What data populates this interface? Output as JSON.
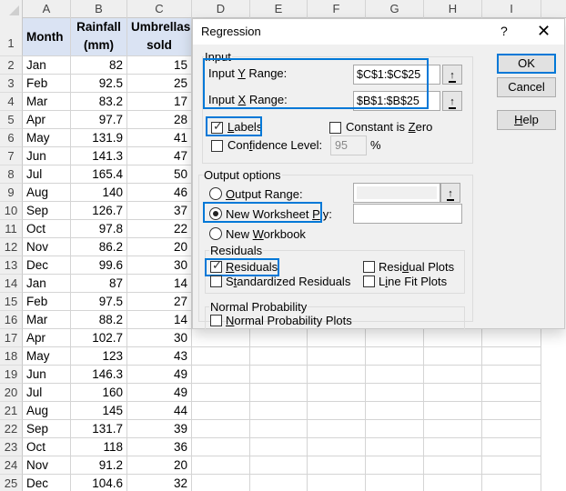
{
  "sheet": {
    "columns": [
      "A",
      "B",
      "C",
      "D",
      "E",
      "F",
      "G",
      "H",
      "I"
    ],
    "header_row_number": "1",
    "headers": {
      "month": "Month",
      "rainfall_line1": "Rainfall",
      "rainfall_line2": "(mm)",
      "umbrellas_line1": "Umbrellas",
      "umbrellas_line2": "sold"
    },
    "rows": [
      {
        "n": "2",
        "month": "Jan",
        "rainfall": "82",
        "umbrellas": "15"
      },
      {
        "n": "3",
        "month": "Feb",
        "rainfall": "92.5",
        "umbrellas": "25"
      },
      {
        "n": "4",
        "month": "Mar",
        "rainfall": "83.2",
        "umbrellas": "17"
      },
      {
        "n": "5",
        "month": "Apr",
        "rainfall": "97.7",
        "umbrellas": "28"
      },
      {
        "n": "6",
        "month": "May",
        "rainfall": "131.9",
        "umbrellas": "41"
      },
      {
        "n": "7",
        "month": "Jun",
        "rainfall": "141.3",
        "umbrellas": "47"
      },
      {
        "n": "8",
        "month": "Jul",
        "rainfall": "165.4",
        "umbrellas": "50"
      },
      {
        "n": "9",
        "month": "Aug",
        "rainfall": "140",
        "umbrellas": "46"
      },
      {
        "n": "10",
        "month": "Sep",
        "rainfall": "126.7",
        "umbrellas": "37"
      },
      {
        "n": "11",
        "month": "Oct",
        "rainfall": "97.8",
        "umbrellas": "22"
      },
      {
        "n": "12",
        "month": "Nov",
        "rainfall": "86.2",
        "umbrellas": "20"
      },
      {
        "n": "13",
        "month": "Dec",
        "rainfall": "99.6",
        "umbrellas": "30"
      },
      {
        "n": "14",
        "month": "Jan",
        "rainfall": "87",
        "umbrellas": "14"
      },
      {
        "n": "15",
        "month": "Feb",
        "rainfall": "97.5",
        "umbrellas": "27"
      },
      {
        "n": "16",
        "month": "Mar",
        "rainfall": "88.2",
        "umbrellas": "14"
      },
      {
        "n": "17",
        "month": "Apr",
        "rainfall": "102.7",
        "umbrellas": "30"
      },
      {
        "n": "18",
        "month": "May",
        "rainfall": "123",
        "umbrellas": "43"
      },
      {
        "n": "19",
        "month": "Jun",
        "rainfall": "146.3",
        "umbrellas": "49"
      },
      {
        "n": "20",
        "month": "Jul",
        "rainfall": "160",
        "umbrellas": "49"
      },
      {
        "n": "21",
        "month": "Aug",
        "rainfall": "145",
        "umbrellas": "44"
      },
      {
        "n": "22",
        "month": "Sep",
        "rainfall": "131.7",
        "umbrellas": "39"
      },
      {
        "n": "23",
        "month": "Oct",
        "rainfall": "118",
        "umbrellas": "36"
      },
      {
        "n": "24",
        "month": "Nov",
        "rainfall": "91.2",
        "umbrellas": "20"
      },
      {
        "n": "25",
        "month": "Dec",
        "rainfall": "104.6",
        "umbrellas": "32"
      }
    ]
  },
  "dialog": {
    "title": "Regression",
    "help_glyph": "?",
    "close_glyph": "✕",
    "input_group": {
      "label": "Input",
      "y_range": {
        "label_pre": "Input ",
        "label_key": "Y",
        "label_post": " Range:",
        "value": "$C$1:$C$25"
      },
      "x_range": {
        "label_pre": "Input ",
        "label_key": "X",
        "label_post": " Range:",
        "value": "$B$1:$B$25"
      },
      "labels": {
        "label_key": "L",
        "label_post": "abels",
        "checked": true
      },
      "constant_zero": {
        "label_pre": "Constant is ",
        "label_key": "Z",
        "label_post": "ero",
        "checked": false
      },
      "confidence": {
        "label_pre": "Con",
        "label_key": "f",
        "label_post": "idence Level:",
        "checked": false,
        "value": "95",
        "unit": "%"
      }
    },
    "output_group": {
      "label": "Output options",
      "output_range": {
        "label_key": "O",
        "label_post": "utput Range:",
        "selected": false,
        "value": ""
      },
      "new_worksheet": {
        "label_pre": "New Worksheet ",
        "label_key": "P",
        "label_post": "ly:",
        "selected": true,
        "value": ""
      },
      "new_workbook": {
        "label_pre": "New ",
        "label_key": "W",
        "label_post": "orkbook",
        "selected": false
      }
    },
    "residuals_group": {
      "label": "Residuals",
      "residuals": {
        "label_key": "R",
        "label_post": "esiduals",
        "checked": true
      },
      "standardized": {
        "label_pre": "S",
        "label_key": "t",
        "label_post": "andardized Residuals",
        "checked": false
      },
      "residual_plots": {
        "label_pre": "Resi",
        "label_key": "d",
        "label_post": "ual Plots",
        "checked": false
      },
      "line_fit": {
        "label_pre": "L",
        "label_key": "i",
        "label_post": "ne Fit Plots",
        "checked": false
      }
    },
    "normal_group": {
      "label": "Normal Probability",
      "normal_plots": {
        "label_key": "N",
        "label_post": "ormal Probability Plots",
        "checked": false
      }
    },
    "buttons": {
      "ok": "OK",
      "cancel": "Cancel",
      "help_key": "H",
      "help_post": "elp"
    },
    "collapse_glyph": "↑",
    "check_glyph": "✓"
  },
  "colors": {
    "accent": "#0078d7",
    "header_fill": "#dae3f3",
    "dialog_bg": "#f0f0f0"
  }
}
